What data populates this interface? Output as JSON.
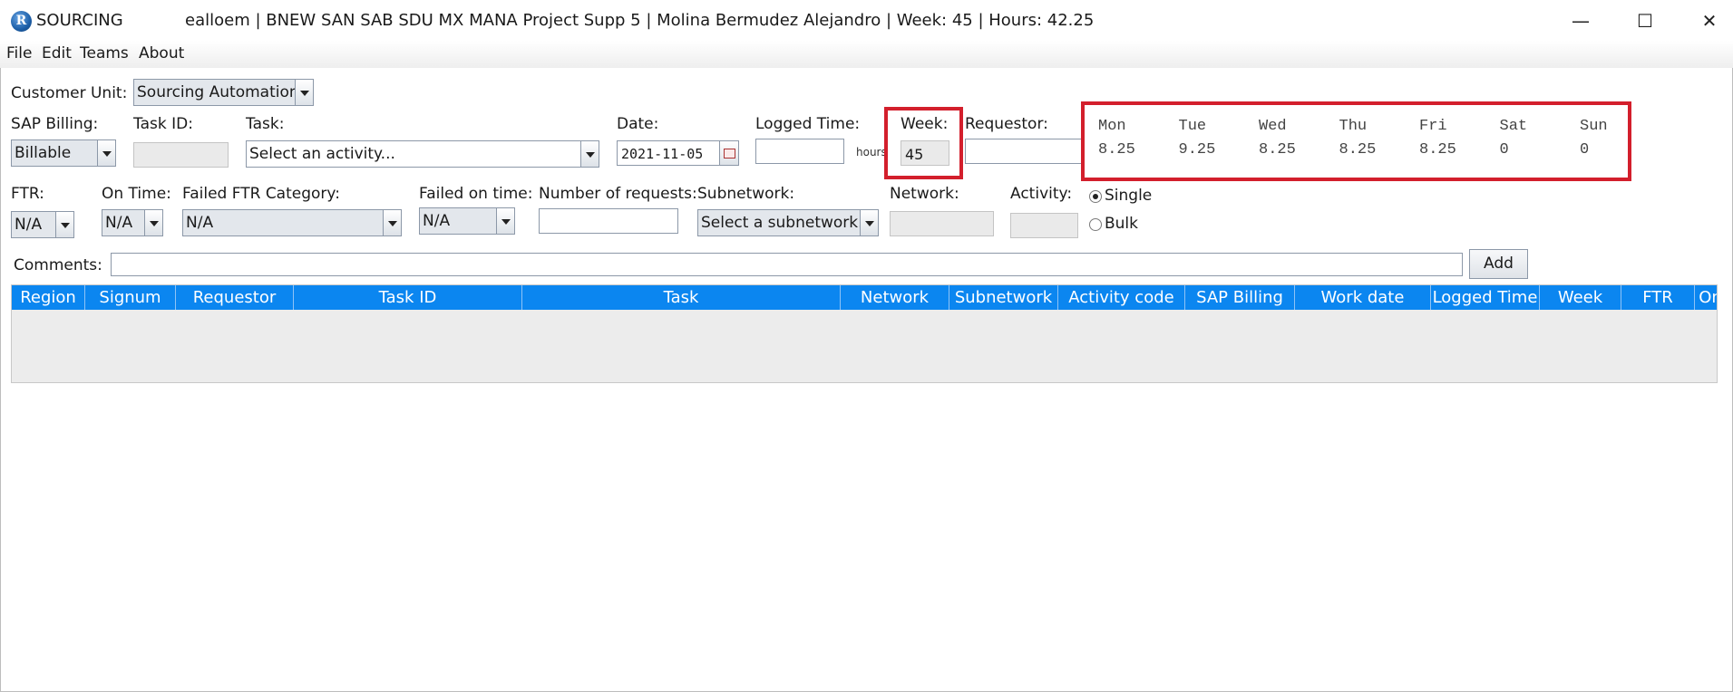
{
  "window": {
    "app_name": "SOURCING",
    "title": "ealloem | BNEW SAN SAB SDU MX MANA Project Supp 5 | Molina Bermudez Alejandro | Week: 45 | Hours: 42.25",
    "minimize_glyph": "—",
    "maximize_glyph": "☐",
    "close_glyph": "✕"
  },
  "menu": [
    "File",
    "Edit",
    "Teams",
    "About"
  ],
  "form": {
    "customer_unit": {
      "label": "Customer Unit:",
      "value": "Sourcing Automation"
    },
    "sap_billing": {
      "label": "SAP Billing:",
      "value": "Billable"
    },
    "task_id": {
      "label": "Task ID:",
      "value": ""
    },
    "task": {
      "label": "Task:",
      "value": "Select an activity..."
    },
    "date": {
      "label": "Date:",
      "value": "2021-11-05"
    },
    "logged_time": {
      "label": "Logged Time:",
      "value": "",
      "unit": "hours"
    },
    "week": {
      "label": "Week:",
      "value": "45"
    },
    "requestor": {
      "label": "Requestor:",
      "value": ""
    },
    "ftr": {
      "label": "FTR:",
      "value": "N/A"
    },
    "on_time": {
      "label": "On Time:",
      "value": "N/A"
    },
    "failed_ftr_category": {
      "label": "Failed FTR Category:",
      "value": "N/A"
    },
    "failed_on_time": {
      "label": "Failed on time:",
      "value": "N/A"
    },
    "number_of_requests": {
      "label": "Number of requests:",
      "value": ""
    },
    "subnetwork": {
      "label": "Subnetwork:",
      "value": "Select a subnetwork..."
    },
    "network": {
      "label": "Network:",
      "value": ""
    },
    "activity": {
      "label": "Activity:",
      "value": ""
    },
    "mode_single": "Single",
    "mode_bulk": "Bulk",
    "comments": {
      "label": "Comments:",
      "value": ""
    },
    "add_label": "Add"
  },
  "week_hours": {
    "days": [
      "Mon",
      "Tue",
      "Wed",
      "Thu",
      "Fri",
      "Sat",
      "Sun"
    ],
    "hours": [
      "8.25",
      "9.25",
      "8.25",
      "8.25",
      "8.25",
      "0",
      "0"
    ]
  },
  "table": {
    "columns": [
      "Region",
      "Signum",
      "Requestor",
      "Task ID",
      "Task",
      "Network",
      "Subnetwork",
      "Activity code",
      "SAP Billing",
      "Work date",
      "Logged Time",
      "Week",
      "FTR",
      "On"
    ],
    "rows": []
  },
  "colors": {
    "header_blue": "#0b86f0",
    "highlight_red": "#d31f2c"
  }
}
